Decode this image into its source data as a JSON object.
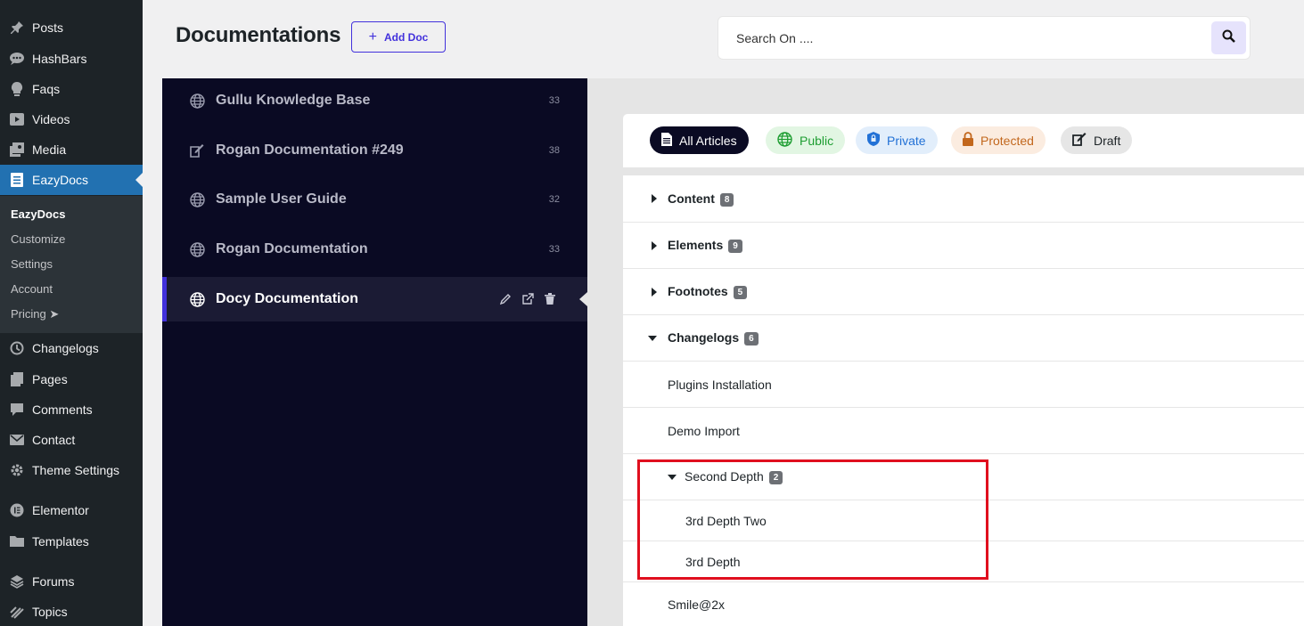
{
  "wp_menu": [
    {
      "label": "Posts",
      "icon": "pin-icon"
    },
    {
      "label": "HashBars",
      "icon": "chat-bubble-icon"
    },
    {
      "label": "Faqs",
      "icon": "lightbulb-icon"
    },
    {
      "label": "Videos",
      "icon": "video-icon"
    },
    {
      "label": "Media",
      "icon": "media-icon"
    },
    {
      "label": "EazyDocs",
      "icon": "document-icon",
      "active": true
    },
    {
      "label": "Changelogs",
      "icon": "history-icon"
    },
    {
      "label": "Pages",
      "icon": "pages-icon"
    },
    {
      "label": "Comments",
      "icon": "comment-icon"
    },
    {
      "label": "Contact",
      "icon": "mail-icon"
    },
    {
      "label": "Theme Settings",
      "icon": "gear-icon"
    },
    {
      "label": "Elementor",
      "icon": "elementor-icon"
    },
    {
      "label": "Templates",
      "icon": "folder-icon"
    },
    {
      "label": "Forums",
      "icon": "forums-icon"
    },
    {
      "label": "Topics",
      "icon": "topics-icon"
    }
  ],
  "wp_submenu": [
    {
      "label": "EazyDocs",
      "current": true
    },
    {
      "label": "Customize"
    },
    {
      "label": "Settings"
    },
    {
      "label": "Account"
    },
    {
      "label": "Pricing ➤"
    }
  ],
  "header": {
    "title": "Documentations",
    "add_doc_label": "Add Doc",
    "search_placeholder": "Search On ...."
  },
  "docs": [
    {
      "label": "Gullu Knowledge Base",
      "count": "33",
      "icon": "globe-icon"
    },
    {
      "label": "Rogan Documentation #249",
      "count": "38",
      "icon": "draft-icon"
    },
    {
      "label": "Sample User Guide",
      "count": "32",
      "icon": "globe-icon"
    },
    {
      "label": "Rogan Documentation",
      "count": "33",
      "icon": "globe-icon"
    },
    {
      "label": "Docy Documentation",
      "count": "",
      "icon": "globe-icon",
      "active": true
    }
  ],
  "filters": {
    "all": "All Articles",
    "public": "Public",
    "private": "Private",
    "protected": "Protected",
    "draft": "Draft"
  },
  "tree": {
    "sections": [
      {
        "label": "Content",
        "count": "8",
        "expanded": false
      },
      {
        "label": "Elements",
        "count": "9",
        "expanded": false
      },
      {
        "label": "Footnotes",
        "count": "5",
        "expanded": false
      },
      {
        "label": "Changelogs",
        "count": "6",
        "expanded": true
      }
    ],
    "changelog_children": [
      "Plugins Installation",
      "Demo Import"
    ],
    "second_depth": {
      "label": "Second Depth",
      "count": "2",
      "expanded": true
    },
    "third_depth": [
      "3rd Depth Two",
      "3rd Depth"
    ],
    "after": [
      "Smile@2x"
    ]
  },
  "colors": {
    "accent": "#4231dc",
    "wp_active": "#2271b1",
    "panel_dark": "#0a0a23",
    "highlight": "#e00f1e"
  }
}
